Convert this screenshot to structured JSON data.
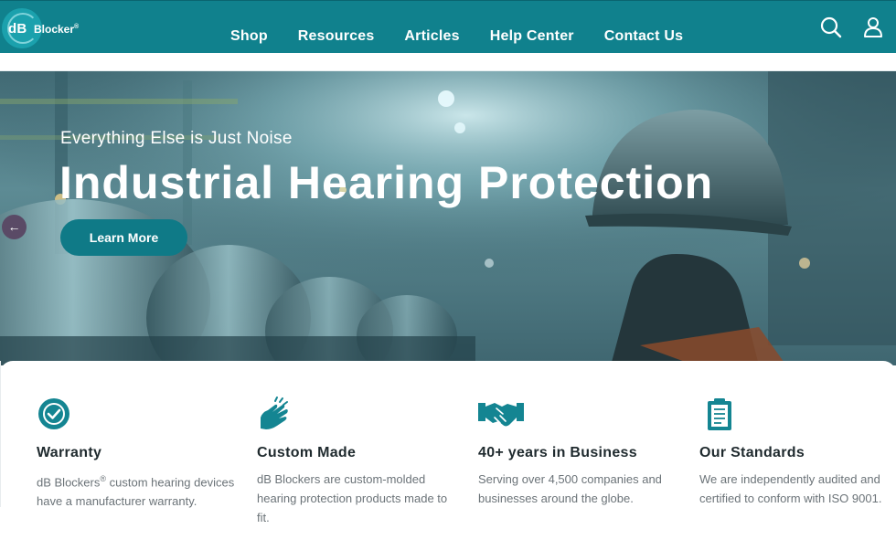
{
  "brand": {
    "logo_db": "dB",
    "logo_text": "Blocker",
    "registered": "®"
  },
  "nav": {
    "items": [
      {
        "label": "Shop"
      },
      {
        "label": "Resources"
      },
      {
        "label": "Articles"
      },
      {
        "label": "Help Center"
      },
      {
        "label": "Contact Us"
      }
    ],
    "search_icon": "search-icon",
    "account_icon": "user-icon"
  },
  "hero": {
    "tagline": "Everything Else is Just Noise",
    "headline": "Industrial Hearing Protection",
    "cta_label": "Learn More",
    "prev_arrow": "←"
  },
  "features": [
    {
      "icon": "check-badge-icon",
      "title": "Warranty",
      "desc_prefix": "dB Blockers",
      "desc_sup": "®",
      "desc": " custom hearing devices have a manufacturer warranty."
    },
    {
      "icon": "clapping-hands-icon",
      "title": "Custom Made",
      "desc": "dB Blockers are custom-molded hearing protection products made to fit."
    },
    {
      "icon": "handshake-icon",
      "title": "40+ years in Business",
      "desc": "Serving over 4,500 companies and businesses around the globe."
    },
    {
      "icon": "clipboard-icon",
      "title": "Our Standards",
      "desc": "We are independently audited and certified to conform with ISO 9001."
    }
  ],
  "colors": {
    "brand_teal": "#10818d",
    "button_teal": "#0f7a87",
    "icon_teal": "#148592"
  }
}
